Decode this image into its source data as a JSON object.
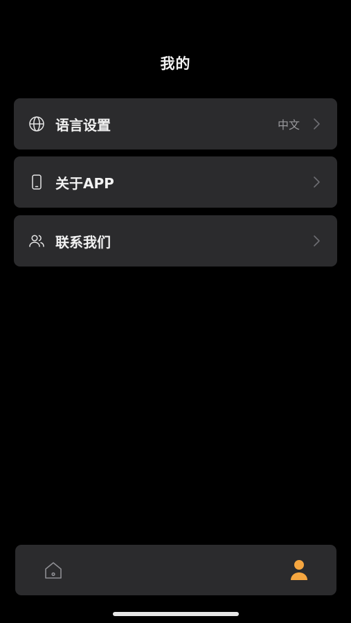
{
  "header": {
    "title": "我的"
  },
  "menu": {
    "language": {
      "label": "语言设置",
      "value": "中文"
    },
    "about": {
      "label": "关于APP"
    },
    "contact": {
      "label": "联系我们"
    }
  },
  "tab_bar": {
    "home_icon": "home-icon",
    "profile_icon": "person-icon",
    "active_color": "#f5a640",
    "inactive_color": "#8e8e93"
  },
  "colors": {
    "background": "#000000",
    "card": "#2b2b2d",
    "accent": "#f5a640"
  }
}
